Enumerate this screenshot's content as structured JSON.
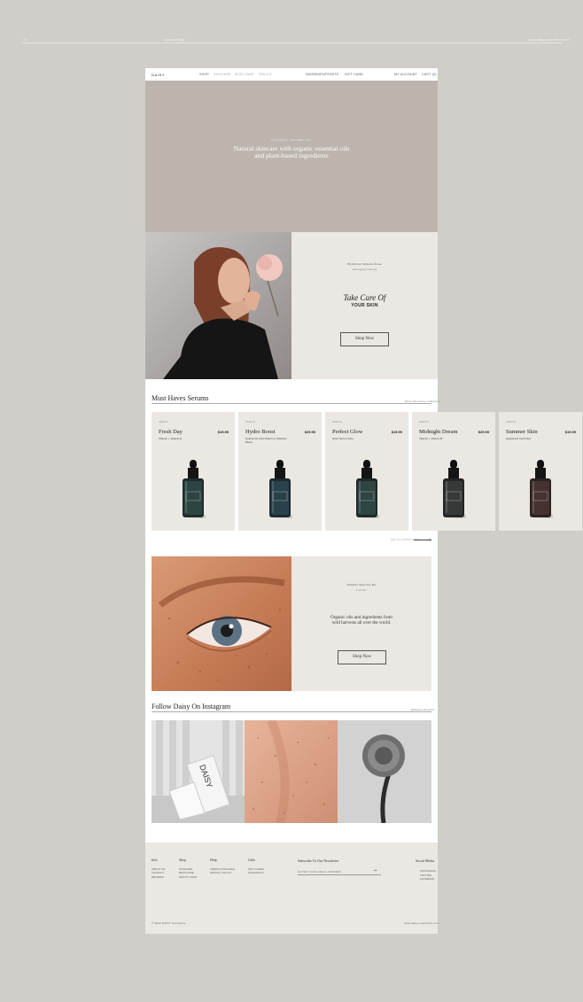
{
  "frame": {
    "page_number": "14",
    "title": "Landing Page",
    "site_url": "www.daisy-cosmetics.com"
  },
  "nav": {
    "logo": "DAISY",
    "links": [
      "SHOP",
      "SKINCARE",
      "BODYCARE",
      "SPA KIT"
    ],
    "secondary": [
      "INGREDIENTS",
      "SETS",
      "GIFT CARD"
    ],
    "right": [
      "MY ACCOUNT",
      "CART (0)"
    ]
  },
  "hero": {
    "kicker": "NATURAL COSMETICS",
    "headline": "Natural skincare with organic essential oils and plant-based ingredients"
  },
  "feature1": {
    "small_title": "Hydration Skincare Rose",
    "small_sub": "Anti-aging Therapy",
    "title_script": "Take Care Of",
    "title_bold": "YOUR SKIN",
    "button": "Shop Now"
  },
  "serums": {
    "heading": "Must Haves Serums",
    "link": "Shop the entire collection",
    "products": [
      {
        "category": "SERUM",
        "name": "Fresh Day",
        "price": "$19.99",
        "desc": "Vitamin + Vitamin E",
        "liquid": "#2f4a45",
        "color": "#1f2b2c"
      },
      {
        "category": "SERUM",
        "name": "Hydro Boost",
        "price": "$29.99",
        "desc": "Hyaluronic Acid Vitamin C Moisture Boost",
        "liquid": "#2c4550",
        "color": "#1e2a30"
      },
      {
        "category": "SERUM",
        "name": "Perfect Glow",
        "price": "$15.99",
        "desc": "Glow Serum Care",
        "liquid": "#314a46",
        "color": "#1d2a29"
      },
      {
        "category": "SERUM",
        "name": "Midnight Dream",
        "price": "$29.99",
        "desc": "Vitamin + Vitamin B",
        "liquid": "#3a3d3b",
        "color": "#242625"
      },
      {
        "category": "SERUM",
        "name": "Summer Skin",
        "price": "$19.99",
        "desc": "Hyaluronic Acid Glow",
        "liquid": "#4a3533",
        "color": "#2c2221"
      }
    ],
    "more_label": "SEE ALL PRODUCTS"
  },
  "feature2": {
    "small_title": "Summer Skincare Kit",
    "small_sub": "Last Kit",
    "body": "Organic oils and ingredients from wild harvests all over the world.",
    "button": "Shop Now"
  },
  "instagram": {
    "heading": "Follow Daisy On Instagram",
    "handle": "@daisycosmetics",
    "box_text": "DAISY"
  },
  "footer": {
    "columns": [
      {
        "title": "Info",
        "items": [
          "ABOUT US",
          "CONTACT",
          "REVIEWS"
        ]
      },
      {
        "title": "Shop",
        "items": [
          "SKINCARE",
          "BODYCARE",
          "SPA KIT SHOP"
        ]
      },
      {
        "title": "Help",
        "items": [
          "TERMS & POLICIES",
          "PRIVACY POLICY"
        ]
      },
      {
        "title": "Gifts",
        "items": [
          "GIFT CARDS",
          "GIVEAWAYS"
        ]
      }
    ],
    "subscribe_title": "Subscribe To Our Newsletter",
    "subscribe_placeholder": "ENTER YOUR EMAIL ADDRESS",
    "subscribe_arrow": "→",
    "social_title": "Social Media",
    "social_items": [
      "INSTAGRAM",
      "TWITTER",
      "FACEBOOK"
    ],
    "copyright": "© 2022 DAISY Cosmetics",
    "email": "www.daisy-cosmetics.com"
  },
  "colors": {
    "bg": "#d1cdc9",
    "hero": "#bcb4ad",
    "panel": "#ebe8e3"
  }
}
